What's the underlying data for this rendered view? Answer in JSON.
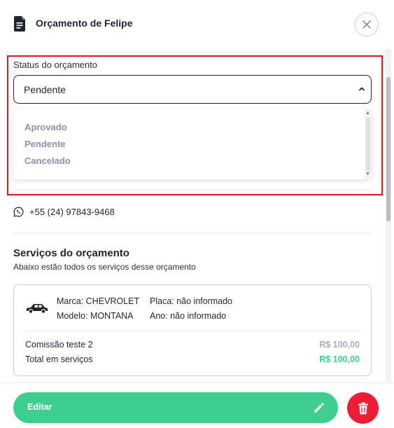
{
  "header": {
    "title": "Orçamento de Felipe",
    "doc_icon": "document-icon",
    "close_icon": "close-icon"
  },
  "status": {
    "label": "Status do orçamento",
    "selected": "Pendente",
    "options": [
      "Aprovado",
      "Pendente",
      "Cancelado"
    ]
  },
  "contact": {
    "icon": "whatsapp-icon",
    "phone": "+55 (24) 97843-9468"
  },
  "services": {
    "title": "Serviços do orçamento",
    "subtitle": "Abaixo estão todos os serviços desse orçamento",
    "vehicle": {
      "icon": "car-icon",
      "brand": "Marca: CHEVROLET",
      "model": "Modelo: MONTANA",
      "plate": "Placa: não informado",
      "year": "Ano: não informado"
    },
    "items": [
      {
        "name": "Comissão teste 2",
        "price": "R$ 100,00"
      }
    ],
    "total_label": "Total em serviços",
    "total_value": "R$ 100,00"
  },
  "actions": {
    "edit_label": "Editar",
    "edit_icon": "pencil-icon",
    "delete_icon": "trash-icon"
  },
  "colors": {
    "accent_green": "#3ecf8e",
    "danger_red": "#ee1d36",
    "highlight_red": "#e0161d",
    "option_text": "#8a90a8"
  }
}
